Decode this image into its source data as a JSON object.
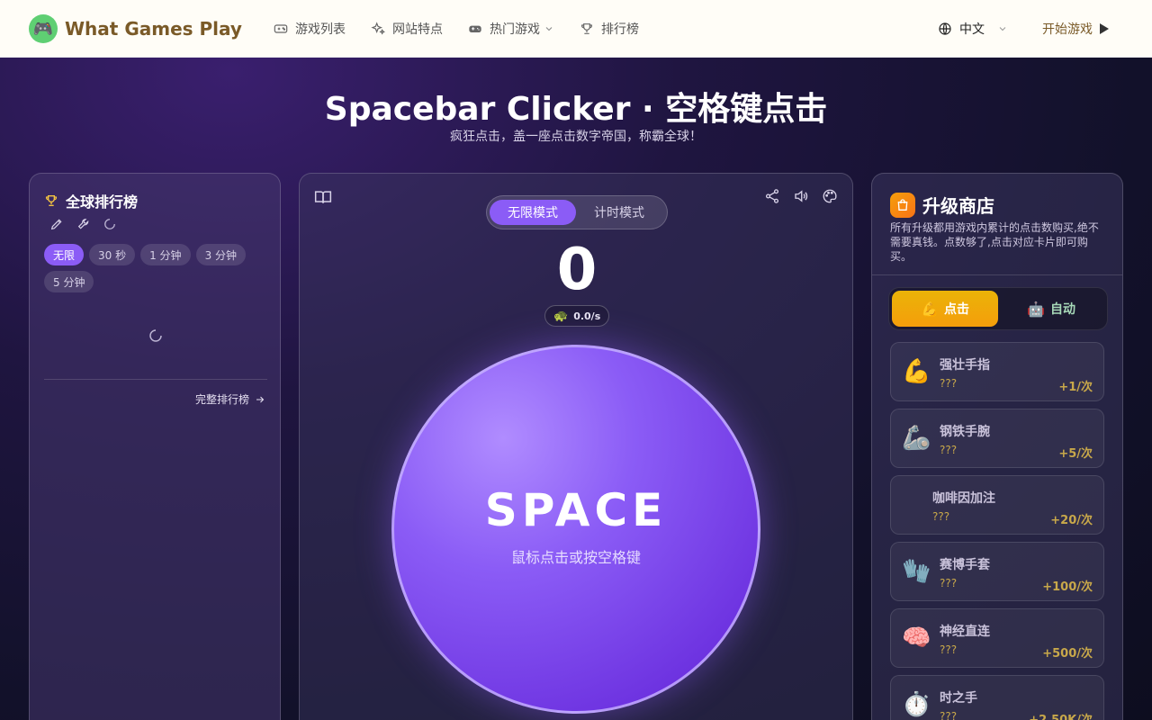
{
  "nav": {
    "brand": "What Games Play",
    "links": [
      "游戏列表",
      "网站特点",
      "热门游戏",
      "排行榜"
    ],
    "language": "中文",
    "start": "开始游戏"
  },
  "hero": {
    "title": "Spacebar Clicker · 空格键点击",
    "subtitle": "疯狂点击，盖一座点击数字帝国，称霸全球！"
  },
  "leaderboard": {
    "title": "全球排行榜",
    "chips": [
      "无限",
      "30 秒",
      "1 分钟",
      "3 分钟",
      "5 分钟"
    ],
    "active_chip": "无限",
    "full_link": "完整排行榜"
  },
  "game": {
    "modes": [
      "无限模式",
      "计时模式"
    ],
    "active_mode": "无限模式",
    "count": "0",
    "rate": "0.0/s",
    "button_label": "SPACE",
    "button_hint": "鼠标点击或按空格键"
  },
  "shop": {
    "title": "升级商店",
    "description": "所有升级都用游戏内累计的点击数购买,绝不需要真钱。点数够了,点击对应卡片即可购买。",
    "tabs": [
      "点击",
      "自动"
    ],
    "active_tab": "点击",
    "items": [
      {
        "icon": "flexed-biceps",
        "emoji": "💪",
        "name": "强壮手指",
        "price": "???",
        "gain": "+1/次"
      },
      {
        "icon": "mechanical-arm",
        "emoji": "🦾",
        "name": "钢铁手腕",
        "price": "???",
        "gain": "+5/次"
      },
      {
        "icon": "coffee",
        "emoji": "",
        "name": "咖啡因加注",
        "price": "???",
        "gain": "+20/次"
      },
      {
        "icon": "gloves",
        "emoji": "🧤",
        "name": "赛博手套",
        "price": "???",
        "gain": "+100/次"
      },
      {
        "icon": "brain",
        "emoji": "🧠",
        "name": "神经直连",
        "price": "???",
        "gain": "+500/次"
      },
      {
        "icon": "stopwatch",
        "emoji": "⏱️",
        "name": "时之手",
        "price": "???",
        "gain": "+2.50K/次"
      }
    ]
  }
}
